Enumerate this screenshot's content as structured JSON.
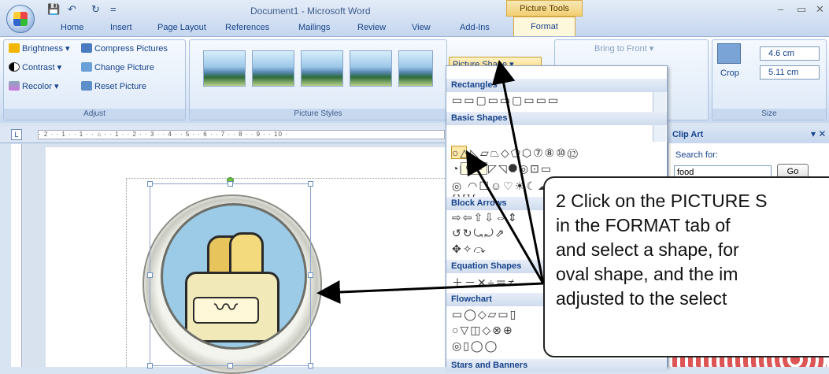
{
  "window": {
    "title": "Document1 - Microsoft Word",
    "contextual_tab": "Picture Tools",
    "controls": [
      "–",
      "▭",
      "✕"
    ]
  },
  "qat": {
    "save": "💾",
    "undo": "↶",
    "redo": "↻",
    "more": "="
  },
  "tabs": [
    "Home",
    "Insert",
    "Page Layout",
    "References",
    "Mailings",
    "Review",
    "View",
    "Add-Ins",
    "Format"
  ],
  "ribbon": {
    "adjust": {
      "label": "Adjust",
      "brightness": "Brightness ▾",
      "contrast": "Contrast ▾",
      "recolor": "Recolor ▾",
      "compress": "Compress Pictures",
      "change": "Change Picture",
      "reset": "Reset Picture"
    },
    "styles": {
      "label": "Picture Styles"
    },
    "arrange": {
      "bring_to_front": "Bring to Front ▾"
    },
    "size": {
      "label": "Size",
      "crop": "Crop",
      "height": "4.6 cm",
      "width": "5.11 cm"
    }
  },
  "picture_shape": {
    "button": "Picture Shape ▾",
    "sections": [
      {
        "name": "Rectangles",
        "glyphs": "▭▭▢▭▭▢▭▭▭"
      },
      {
        "name": "Basic Shapes",
        "glyphs": "○△◺▱⏢◇⬠⬡⑦⑧⑩⑫"
      },
      {
        "name": "",
        "glyphs": "◔◣▰⌐◸◹⯃◎⊡▭"
      },
      {
        "name": "",
        "glyphs": "◎ ◠☐☺♡☀☾☁⌒()"
      },
      {
        "name": "",
        "glyphs": "{}[]{"
      },
      {
        "name": "Block Arrows",
        "glyphs": "⇨⇦⇧⇩⇔⇕"
      },
      {
        "name": "",
        "glyphs": "↺↻⤿⤾⇗"
      },
      {
        "name": "",
        "glyphs": "✥✧⤼"
      },
      {
        "name": "Equation Shapes",
        "glyphs": "＋－✕÷＝≠"
      },
      {
        "name": "Flowchart",
        "glyphs": "▭◯◇▱▭▯"
      },
      {
        "name": "",
        "glyphs": "○▽◫◇⊗⊕"
      },
      {
        "name": "",
        "glyphs": "◎▯◯◯"
      },
      {
        "name": "Stars and Banners",
        "glyphs": ""
      }
    ],
    "tooltip": "Oval"
  },
  "ruler": {
    "text": "· 2 · · 1 · · 1 · · ⌂ · · 1 · · 2 · · 3 · · 4 · · 5 · · 6 · · 7 · · 8 · · 9 · · 10 ·"
  },
  "clipart": {
    "title": "Clip Art",
    "search_label": "Search for:",
    "search_value": "food",
    "go": "Go"
  },
  "callout": {
    "text": "2 Click on the PICTURE S\nin the FORMAT tab of\nand select a shape, for\noval shape, and the im\nadjusted to the select"
  },
  "colors": {
    "accent": "#15428b",
    "contextual": "#f2cf72"
  }
}
